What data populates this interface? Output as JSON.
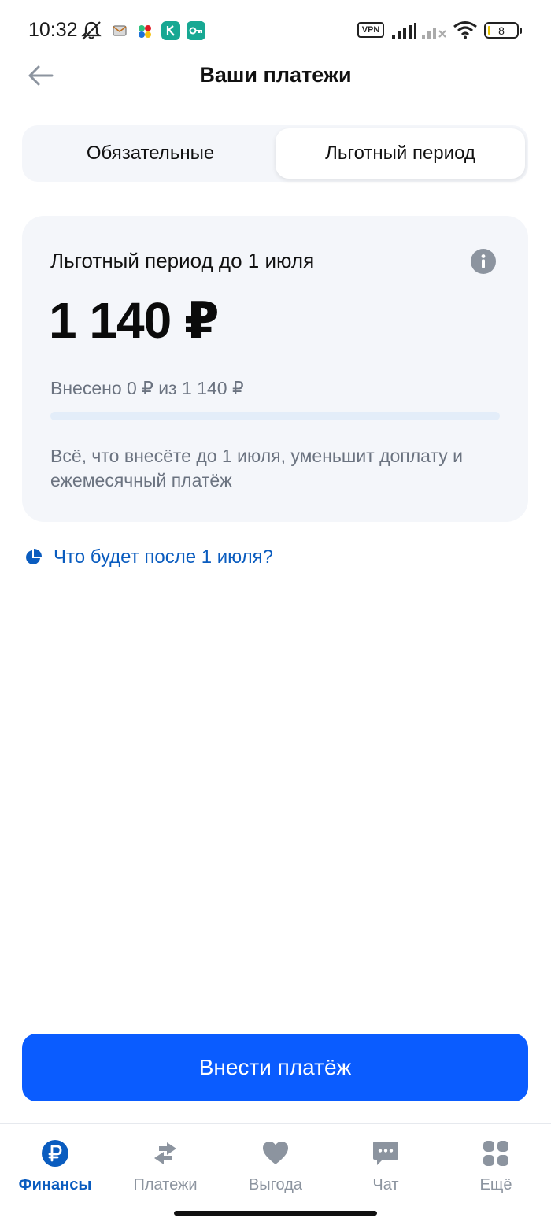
{
  "status_bar": {
    "time": "10:32",
    "vpn_label": "VPN",
    "battery_level": "8"
  },
  "header": {
    "title": "Ваши платежи"
  },
  "tabs": [
    {
      "label": "Обязательные",
      "active": false
    },
    {
      "label": "Льготный период",
      "active": true
    }
  ],
  "card": {
    "heading": "Льготный период до 1 июля",
    "amount": "1 140 ₽",
    "paid_text": "Внесено 0 ₽ из 1 140 ₽",
    "progress_fraction": 0,
    "note": "Всё, что внесёте до 1 июля, уменьшит доплату и ежемесячный платёж"
  },
  "info_link": {
    "label": "Что будет после 1 июля?"
  },
  "primary_button": {
    "label": "Внести платёж"
  },
  "bottom_nav": [
    {
      "label": "Финансы",
      "icon": "ruble-icon",
      "active": true
    },
    {
      "label": "Платежи",
      "icon": "transfer-arrows-icon",
      "active": false
    },
    {
      "label": "Выгода",
      "icon": "heart-icon",
      "active": false
    },
    {
      "label": "Чат",
      "icon": "chat-icon",
      "active": false
    },
    {
      "label": "Ещё",
      "icon": "grid-icon",
      "active": false
    }
  ],
  "colors": {
    "accent": "#0a5cff",
    "link": "#0a5cbf",
    "card_bg": "#f4f6fa",
    "muted_text": "#6b7380",
    "icon_gray": "#8c949f"
  }
}
